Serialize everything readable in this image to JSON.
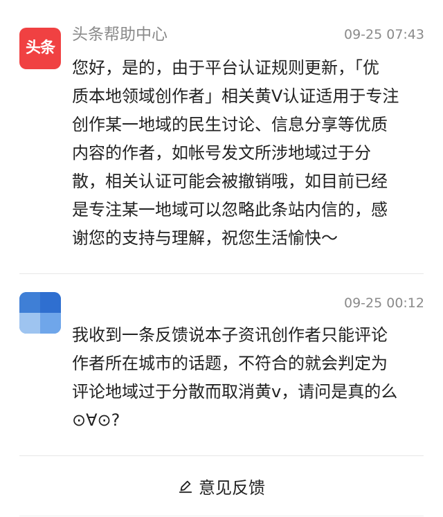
{
  "messages": [
    {
      "sender": "头条帮助中心",
      "avatar_text": "头条",
      "time": "09-25 07:43",
      "text": "您好，是的，由于平台认证规则更新，「优\n质本地领域创作者」相关黄V认证适用于专注\n创作某一地域的民生讨论、信息分享等优质\n内容的作者，如帐号发文所涉地域过于分\n散，相关认证可能会被撤销哦，如目前已经\n是专注某一地域可以忽略此条站内信的，感\n谢您的支持与理解，祝您生活愉快～"
    },
    {
      "sender": "",
      "time": "09-25 00:12",
      "text": "我收到一条反馈说本子资讯创作者只能评论\n作者所在城市的话题，不符合的就会判定为\n评论地域过于分散而取消黄v，请问是真的么\n⊙∀⊙?"
    }
  ],
  "footer": {
    "feedback_label": "意见反馈",
    "icon": "pencil-icon"
  },
  "colors": {
    "brand_red": "#f04142",
    "meta_gray": "#8a8a8a",
    "text": "#222222",
    "divider": "#e6e6e6"
  }
}
